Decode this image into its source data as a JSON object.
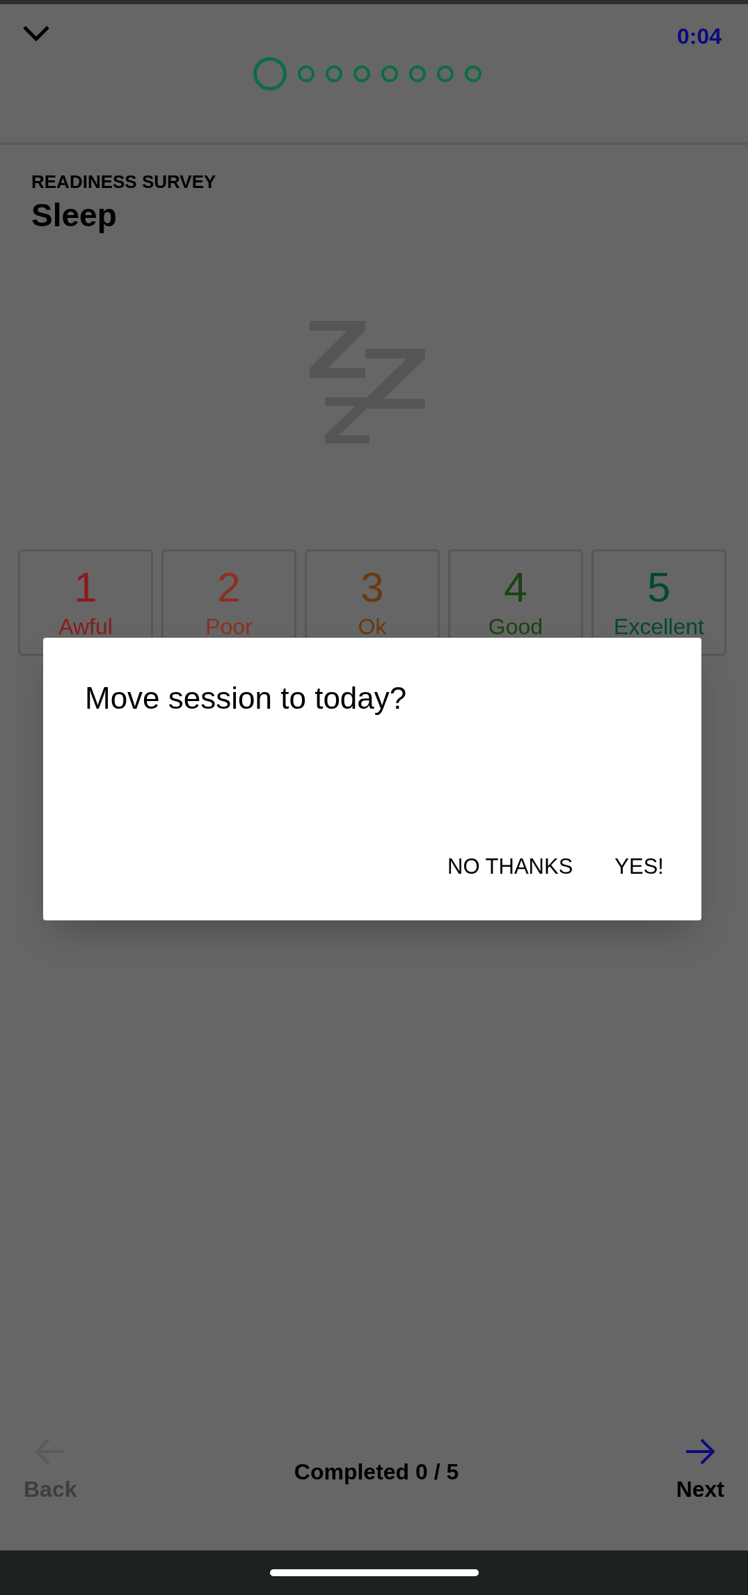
{
  "header": {
    "timer": "0:04",
    "steps": [
      {
        "selected": true
      },
      {
        "selected": false
      },
      {
        "selected": false
      },
      {
        "selected": false
      },
      {
        "selected": false
      },
      {
        "selected": false
      },
      {
        "selected": false
      },
      {
        "selected": false
      }
    ]
  },
  "survey": {
    "eyebrow": "READINESS SURVEY",
    "title": "Sleep"
  },
  "ratings": [
    {
      "number": "1",
      "label": "Awful",
      "color": "#8b1a1a"
    },
    {
      "number": "2",
      "label": "Poor",
      "color": "#8e2f22"
    },
    {
      "number": "3",
      "label": "Ok",
      "color": "#6a3a0c"
    },
    {
      "number": "4",
      "label": "Good",
      "color": "#1c4214"
    },
    {
      "number": "5",
      "label": "Excellent",
      "color": "#004a2c"
    }
  ],
  "dialog": {
    "title": "Move session to today?",
    "buttons": [
      "NO THANKS",
      "YES!"
    ]
  },
  "footer": {
    "back": {
      "label": "Back",
      "disabled": true
    },
    "progress": "Completed 0 / 5",
    "next": {
      "label": "Next",
      "disabled": false
    }
  }
}
